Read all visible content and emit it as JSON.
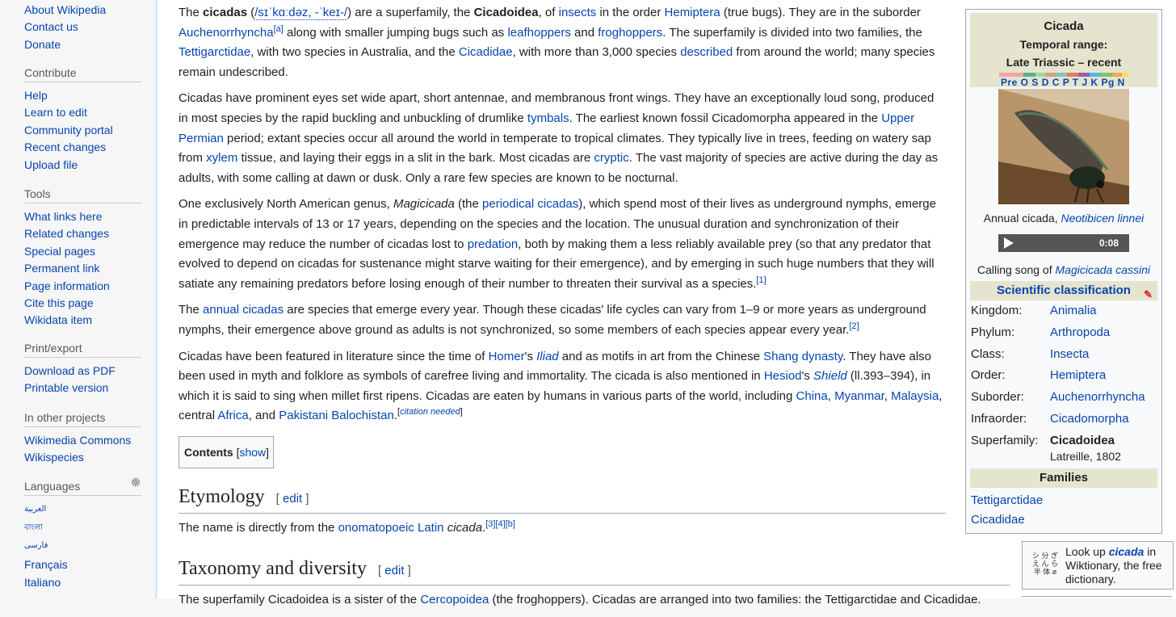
{
  "sidebar": {
    "top_items": [
      "About Wikipedia",
      "Contact us",
      "Donate"
    ],
    "contribute": {
      "head": "Contribute",
      "items": [
        "Help",
        "Learn to edit",
        "Community portal",
        "Recent changes",
        "Upload file"
      ]
    },
    "tools": {
      "head": "Tools",
      "items": [
        "What links here",
        "Related changes",
        "Special pages",
        "Permanent link",
        "Page information",
        "Cite this page",
        "Wikidata item"
      ]
    },
    "print": {
      "head": "Print/export",
      "items": [
        "Download as PDF",
        "Printable version"
      ]
    },
    "other": {
      "head": "In other projects",
      "items": [
        "Wikimedia Commons",
        "Wikispecies"
      ]
    },
    "languages": {
      "head": "Languages",
      "items": [
        "العربية",
        "বাংলা",
        "فارسی",
        "Français",
        "Italiano"
      ]
    }
  },
  "article": {
    "p1": {
      "t1": "The ",
      "b1": "cicadas",
      "t2": " (",
      "ipa": "/sɪˈkɑːdəz, -ˈkeɪ-/",
      "t3": ") are a superfamily, the ",
      "b2": "Cicadoidea",
      "t4": ", of ",
      "l1": "insects",
      "t5": " in the order ",
      "l2": "Hemiptera",
      "t6": " (true bugs). They are in the suborder ",
      "l3": "Auchenorrhyncha",
      "s1": "[a]",
      "t7": " along with smaller jumping bugs such as ",
      "l4": "leafhoppers",
      "t8": " and ",
      "l5": "froghoppers",
      "t9": ". The superfamily is divided into two families, the ",
      "l6": "Tettigarctidae",
      "t10": ", with two species in Australia, and the ",
      "l7": "Cicadidae",
      "t11": ", with more than 3,000 species ",
      "l8": "described",
      "t12": " from around the world; many species remain undescribed."
    },
    "p2": {
      "t1": "Cicadas have prominent eyes set wide apart, short antennae, and membranous front wings. They have an exceptionally loud song, produced in most species by the rapid buckling and unbuckling of drumlike ",
      "l1": "tymbals",
      "t2": ". The earliest known fossil Cicadomorpha appeared in the ",
      "l2": "Upper Permian",
      "t3": " period; extant species occur all around the world in temperate to tropical climates. They typically live in trees, feeding on watery sap from ",
      "l3": "xylem",
      "t4": " tissue, and laying their eggs in a slit in the bark. Most cicadas are ",
      "l4": "cryptic",
      "t5": ". The vast majority of species are active during the day as adults, with some calling at dawn or dusk. Only a rare few species are known to be nocturnal."
    },
    "p3": {
      "t1": "One exclusively North American genus, ",
      "i1": "Magicicada",
      "t2": " (the ",
      "l1": "periodical cicadas",
      "t3": "), which spend most of their lives as underground nymphs, emerge in predictable intervals of 13 or 17 years, depending on the species and the location. The unusual duration and synchronization of their emergence may reduce the number of cicadas lost to ",
      "l2": "predation",
      "t4": ", both by making them a less reliably available prey (so that any predator that evolved to depend on cicadas for sustenance might starve waiting for their emergence), and by emerging in such huge numbers that they will satiate any remaining predators before losing enough of their number to threaten their survival as a species.",
      "s1": "[1]"
    },
    "p4": {
      "t1": "The ",
      "l1": "annual cicadas",
      "t2": " are species that emerge every year. Though these cicadas' life cycles can vary from 1–9 or more years as underground nymphs, their emergence above ground as adults is not synchronized, so some members of each species appear every year.",
      "s1": "[2]"
    },
    "p5": {
      "t1": "Cicadas have been featured in literature since the time of ",
      "l1": "Homer",
      "t2": "'s ",
      "l2": "Iliad",
      "t3": " and as motifs in art from the Chinese ",
      "l3": "Shang dynasty",
      "t4": ". They have also been used in myth and folklore as symbols of carefree living and immortality. The cicada is also mentioned in ",
      "l4": "Hesiod",
      "t5": "'s ",
      "l5": "Shield",
      "t6": " (ll.393–394), in which it is said to sing when millet first ripens. Cicadas are eaten by humans in various parts of the world, including ",
      "l6": "China",
      "t7": ", ",
      "l7": "Myanmar",
      "t8": ", ",
      "l8": "Malaysia",
      "t9": ", central ",
      "l9": "Africa",
      "t10": ", and ",
      "l10": "Pakistani Balochistan",
      "t11": ".",
      "s1a": "[",
      "s1": "citation needed",
      "s1b": "]"
    },
    "toc": {
      "title": "Contents",
      "open": "[",
      "show": "show",
      "close": "]"
    },
    "etymology": {
      "heading": "Etymology",
      "edit_open": "[ ",
      "edit": "edit",
      "edit_close": " ]",
      "t1": "The name is directly from the ",
      "l1": "onomatopoeic",
      "t2": " ",
      "l2": "Latin",
      "t3": " ",
      "i1": "cicada",
      "t4": ".",
      "s1": "[3]",
      "s2": "[4]",
      "s3": "[b]"
    },
    "taxonomy": {
      "heading": "Taxonomy and diversity",
      "edit_open": "[ ",
      "edit": "edit",
      "edit_close": " ]",
      "t1": "The superfamily Cicadoidea is a sister of the ",
      "l1": "Cercopoidea",
      "t2": " (the froghoppers). Cicadas are arranged into two families: the Tettigarctidae and Cicadidae."
    }
  },
  "infobox": {
    "title": "Cicada",
    "range_label": "Temporal range:",
    "range": "Late Triassic – recent",
    "timescale_labels": "Pre  O S D C P T J K Pg N",
    "caption1_text": "Annual cicada, ",
    "caption1_link": "Neotibicen linnei",
    "audio_time": "0:08",
    "caption2_text": "Calling song of ",
    "caption2_link": "Magicicada cassini",
    "sci_head": "Scientific classification",
    "rows": [
      {
        "key": "Kingdom:",
        "val": "Animalia"
      },
      {
        "key": "Phylum:",
        "val": "Arthropoda"
      },
      {
        "key": "Class:",
        "val": "Insecta"
      },
      {
        "key": "Order:",
        "val": "Hemiptera"
      },
      {
        "key": "Suborder:",
        "val": "Auchenorrhyncha"
      },
      {
        "key": "Infraorder:",
        "val": "Cicadomorpha"
      },
      {
        "key": "Superfamily:",
        "val": "Cicadoidea"
      }
    ],
    "authority": "Latreille, 1802",
    "families_head": "Families",
    "families": [
      "Tettigarctidae",
      "Cicadidae"
    ]
  },
  "wiktionary": {
    "look_up": "Look up ",
    "word": "cicada",
    "rest": " in Wiktionary, the free dictionary."
  },
  "colors": {
    "link": "#0645ad",
    "infobox_head": "#e5e4cf",
    "border": "#a2a9b1",
    "sidebar_bg": "#f6f6f6"
  }
}
